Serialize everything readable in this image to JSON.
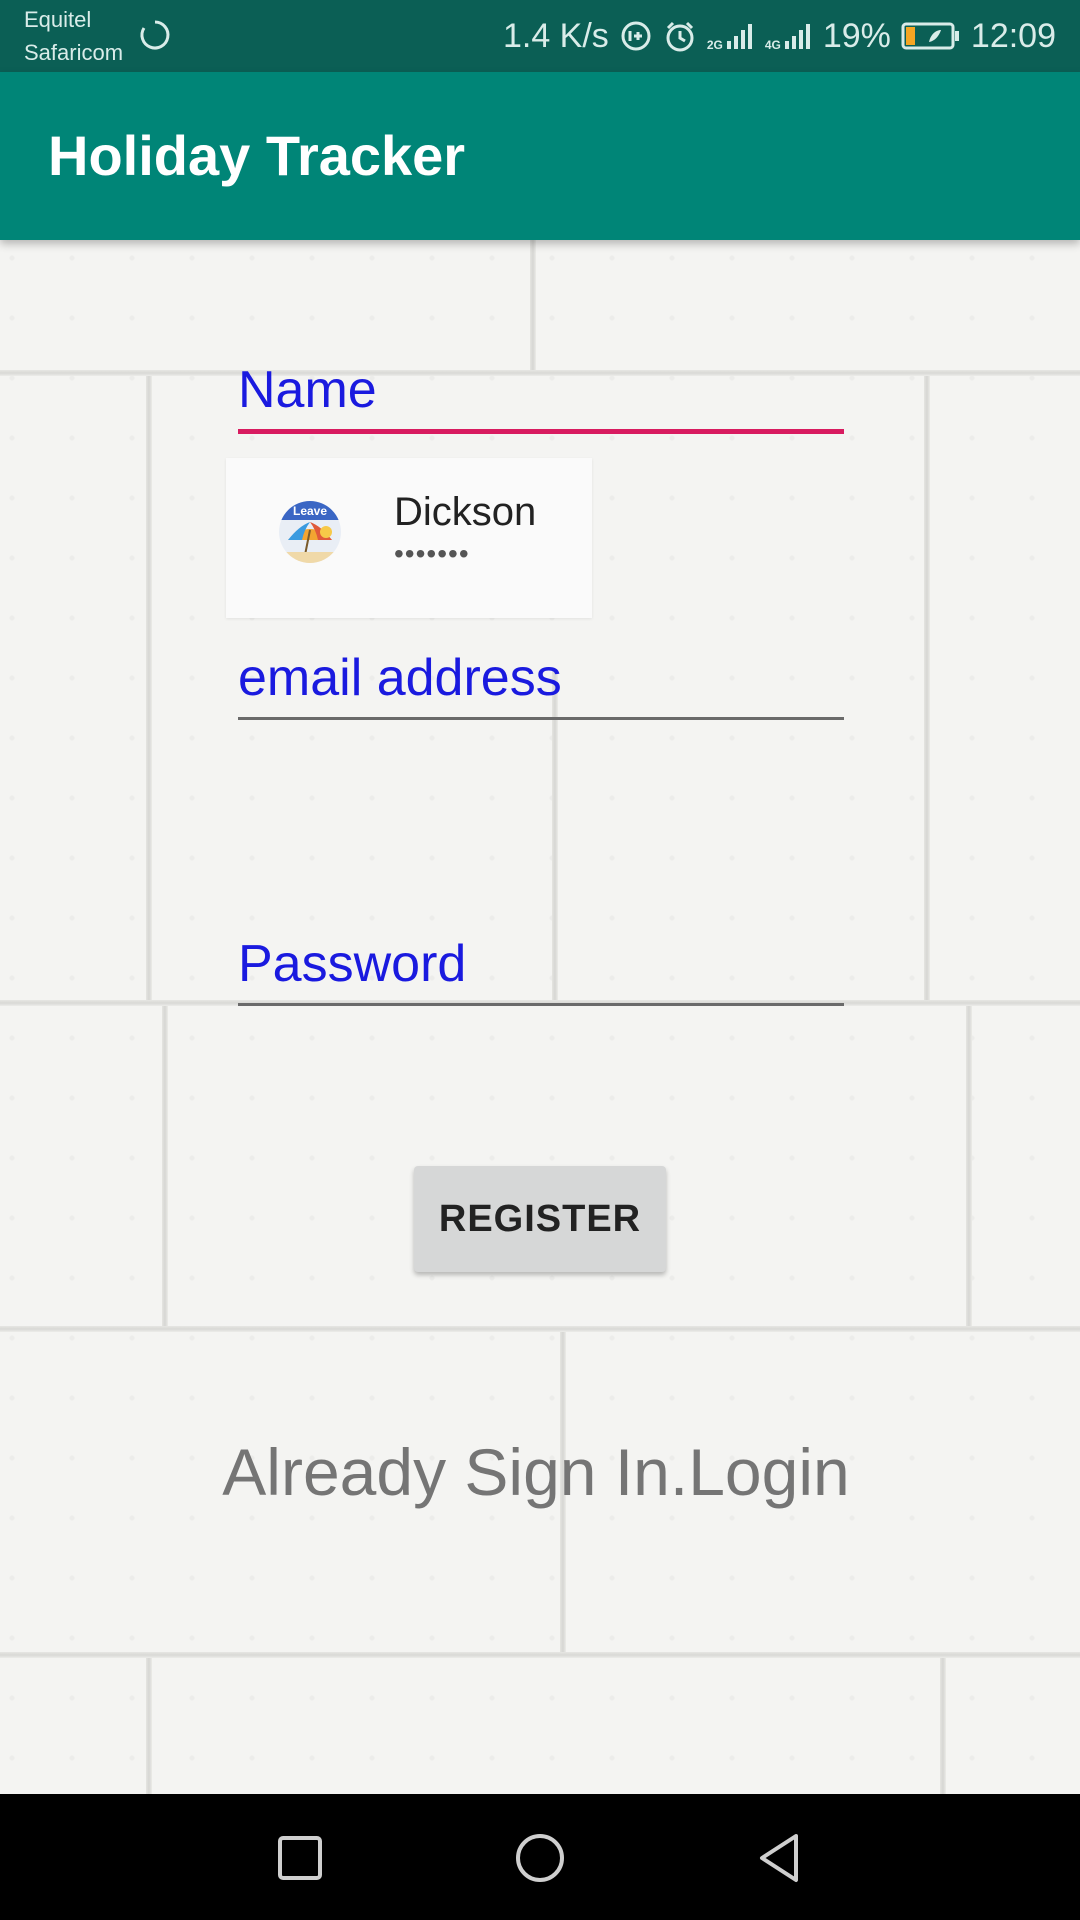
{
  "status_bar": {
    "carrier_1": "Equitel",
    "carrier_2": "Safaricom",
    "speed": "1.4 K/s",
    "net_2g": "2G",
    "net_4g": "4G",
    "battery": "19%",
    "time": "12:09",
    "icons": [
      "sync-icon",
      "data-saver-icon",
      "alarm-icon",
      "signal-icon",
      "battery-icon"
    ]
  },
  "app_bar": {
    "title": "Holiday Tracker"
  },
  "form": {
    "name_label": "Name",
    "email_label": "email address",
    "password_label": "Password",
    "register_label": "REGISTER",
    "login_link": "Already Sign In.Login"
  },
  "autofill": {
    "username": "Dickson",
    "password_mask": "•••••••",
    "avatar_text": "Leave"
  },
  "nav_bar": {
    "icons": [
      "recents-icon",
      "home-icon",
      "back-icon"
    ]
  },
  "colors": {
    "status_bar": "#0b5f55",
    "app_bar": "#008577",
    "label": "#1a1adf",
    "focus_line": "#d81b60",
    "button": "#d6d7d7"
  }
}
